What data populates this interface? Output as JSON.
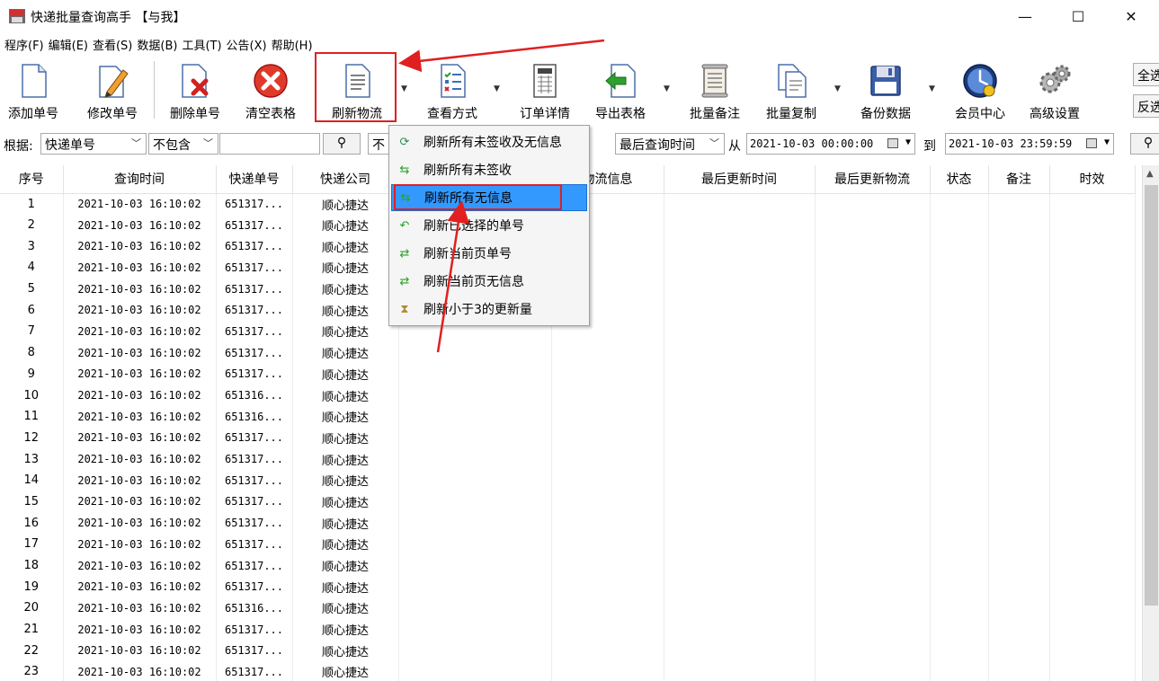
{
  "window": {
    "title": "快递批量查询高手 【与我】",
    "controls": {
      "minimize": "—",
      "maximize": "☐",
      "close": "✕"
    }
  },
  "menubar": [
    "程序(F)",
    "编辑(E)",
    "查看(S)",
    "数据(B)",
    "工具(T)",
    "公告(X)",
    "帮助(H)"
  ],
  "toolbar": {
    "add": "添加单号",
    "edit": "修改单号",
    "delete": "删除单号",
    "clear": "清空表格",
    "refresh": "刷新物流",
    "view": "查看方式",
    "order_detail": "订单详情",
    "export": "导出表格",
    "batch_note": "批量备注",
    "batch_copy": "批量复制",
    "backup": "备份数据",
    "member": "会员中心",
    "advanced": "高级设置",
    "side_top": "全选",
    "side_bottom": "反选"
  },
  "filter": {
    "by_label": "根据:",
    "field": "快递单号",
    "condition": "不包含",
    "text_value": "",
    "condition2_partial": "不",
    "time_field": "最后查询时间",
    "from_label": "从",
    "from_date": "2021-10-03 00:00:00",
    "to_label": "到",
    "to_date": "2021-10-03 23:59:59"
  },
  "table": {
    "columns": [
      "序号",
      "查询时间",
      "快递单号",
      "快递公司",
      "",
      "物流信息",
      "最后更新时间",
      "最后更新物流",
      "状态",
      "备注",
      "时效"
    ],
    "rows": [
      [
        "1",
        "2021-10-03 16:10:02",
        "651317...",
        "顺心捷达"
      ],
      [
        "2",
        "2021-10-03 16:10:02",
        "651317...",
        "顺心捷达"
      ],
      [
        "3",
        "2021-10-03 16:10:02",
        "651317...",
        "顺心捷达"
      ],
      [
        "4",
        "2021-10-03 16:10:02",
        "651317...",
        "顺心捷达"
      ],
      [
        "5",
        "2021-10-03 16:10:02",
        "651317...",
        "顺心捷达"
      ],
      [
        "6",
        "2021-10-03 16:10:02",
        "651317...",
        "顺心捷达"
      ],
      [
        "7",
        "2021-10-03 16:10:02",
        "651317...",
        "顺心捷达"
      ],
      [
        "8",
        "2021-10-03 16:10:02",
        "651317...",
        "顺心捷达"
      ],
      [
        "9",
        "2021-10-03 16:10:02",
        "651317...",
        "顺心捷达"
      ],
      [
        "10",
        "2021-10-03 16:10:02",
        "651316...",
        "顺心捷达"
      ],
      [
        "11",
        "2021-10-03 16:10:02",
        "651316...",
        "顺心捷达"
      ],
      [
        "12",
        "2021-10-03 16:10:02",
        "651317...",
        "顺心捷达"
      ],
      [
        "13",
        "2021-10-03 16:10:02",
        "651317...",
        "顺心捷达"
      ],
      [
        "14",
        "2021-10-03 16:10:02",
        "651317...",
        "顺心捷达"
      ],
      [
        "15",
        "2021-10-03 16:10:02",
        "651317...",
        "顺心捷达"
      ],
      [
        "16",
        "2021-10-03 16:10:02",
        "651317...",
        "顺心捷达"
      ],
      [
        "17",
        "2021-10-03 16:10:02",
        "651317...",
        "顺心捷达"
      ],
      [
        "18",
        "2021-10-03 16:10:02",
        "651317...",
        "顺心捷达"
      ],
      [
        "19",
        "2021-10-03 16:10:02",
        "651317...",
        "顺心捷达"
      ],
      [
        "20",
        "2021-10-03 16:10:02",
        "651316...",
        "顺心捷达"
      ],
      [
        "21",
        "2021-10-03 16:10:02",
        "651317...",
        "顺心捷达"
      ],
      [
        "22",
        "2021-10-03 16:10:02",
        "651317...",
        "顺心捷达"
      ],
      [
        "23",
        "2021-10-03 16:10:02",
        "651317...",
        "顺心捷达"
      ]
    ]
  },
  "popup_menu": {
    "items": [
      {
        "label": "刷新所有未签收及无信息",
        "icon": "refresh-globe-icon"
      },
      {
        "label": "刷新所有未签收",
        "icon": "refresh-arrows-icon"
      },
      {
        "label": "刷新所有无信息",
        "icon": "refresh-arrows-icon",
        "selected": true
      },
      {
        "label": "刷新已选择的单号",
        "icon": "undo-arrow-icon"
      },
      {
        "label": "刷新当前页单号",
        "icon": "shuffle-icon"
      },
      {
        "label": "刷新当前页无信息",
        "icon": "shuffle-icon"
      },
      {
        "label": "刷新小于3的更新量",
        "icon": "hourglass-icon"
      }
    ]
  },
  "colors": {
    "annotation_red": "#e02020",
    "menu_selected": "#3399ff"
  }
}
